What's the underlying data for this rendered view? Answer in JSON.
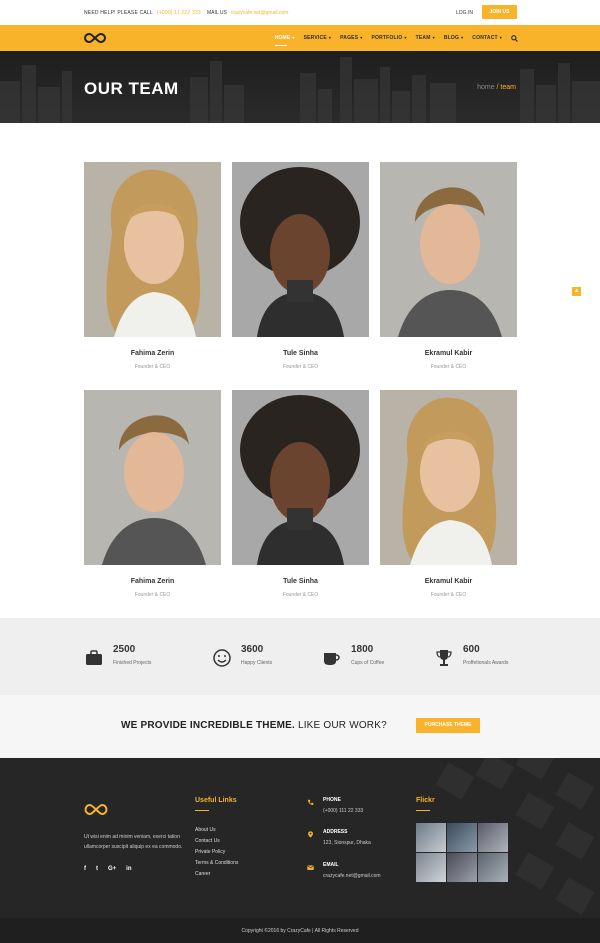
{
  "topbar": {
    "help_label": "NEED HELP! PLEASE CALL",
    "phone": "(+000) 11 222 333",
    "mail_label": "MAIL US",
    "email": "crazycafe.net@gmail.com",
    "login": "LOG IN",
    "join": "JOIN US"
  },
  "nav": {
    "items": [
      {
        "label": "HOME"
      },
      {
        "label": "SERVICE"
      },
      {
        "label": "PAGES"
      },
      {
        "label": "PORTFOLIO"
      },
      {
        "label": "TEAM"
      },
      {
        "label": "BLOG"
      },
      {
        "label": "CONTACT"
      }
    ],
    "active_color": "#ffffff",
    "brand_color": "#f8b32b"
  },
  "hero": {
    "title": "OUR TEAM",
    "crumb_home": "home",
    "crumb_current": "/ team"
  },
  "team": [
    {
      "name": "Fahima Zerin",
      "role": "Founder & CEO"
    },
    {
      "name": "Tule Sinha",
      "role": "Founder & CEO"
    },
    {
      "name": "Ekramul Kabir",
      "role": "Founder & CEO"
    },
    {
      "name": "Fahima Zerin",
      "role": "Founder & CEO"
    },
    {
      "name": "Tule Sinha",
      "role": "Founder & CEO"
    },
    {
      "name": "Ekramul Kabir",
      "role": "Founder & CEO"
    }
  ],
  "stats": [
    {
      "value": "2500",
      "label": "Finished Projects",
      "icon": "briefcase-icon"
    },
    {
      "value": "3600",
      "label": "Happy Clients",
      "icon": "smile-icon"
    },
    {
      "value": "1800",
      "label": "Cups of Coffee",
      "icon": "coffee-cup-icon"
    },
    {
      "value": "600",
      "label": "Proffetionals Awards",
      "icon": "trophy-icon"
    }
  ],
  "cta": {
    "bold": "WE PROVIDE INCREDIBLE THEME.",
    "rest": "LIKE OUR WORK?",
    "button": "PURCHASE THEME"
  },
  "footer": {
    "about": "Ut wisi enim ad minim veniam, exerci tation ullamcorper suscipit aliquip ex ea commodo.",
    "social": [
      "f",
      "t",
      "G+",
      "in"
    ],
    "links_title": "Useful Links",
    "links": [
      "About Us",
      "Contact Us",
      "Private Policy",
      "Terms & Conditions",
      "Career"
    ],
    "phone_label": "PHONE",
    "phone_value": "(+000) 111 22 333",
    "address_label": "ADDRESS",
    "address_value": "123, Sionspur, Dhaka",
    "email_label": "EMAIL",
    "email_value": "crazycafe.net@gmail.com",
    "flickr_title": "Flickr",
    "copyright": "Copyright ©2016 by CrazyCafe  |  All Rights Reserved"
  }
}
